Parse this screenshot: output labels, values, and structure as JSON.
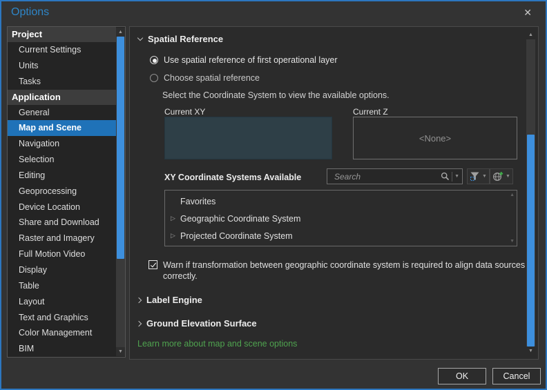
{
  "window": {
    "title": "Options"
  },
  "icons": {
    "close": "✕",
    "up": "▲",
    "down": "▼",
    "expand": "▷",
    "dropdown": "▼"
  },
  "colors": {
    "dialog_border": "#2c77c0",
    "title_blue": "#2e86c8",
    "selection_blue": "#1f72b8",
    "scrollbar_blue": "#3d8fdd",
    "link_green": "#4fa34f",
    "current_xy_fill": "#2e3f47"
  },
  "sidebar": {
    "sections": [
      {
        "header": "Project",
        "items": [
          {
            "label": "Current Settings"
          },
          {
            "label": "Units"
          },
          {
            "label": "Tasks"
          }
        ]
      },
      {
        "header": "Application",
        "items": [
          {
            "label": "General"
          },
          {
            "label": "Map and Scene",
            "selected": true
          },
          {
            "label": "Navigation"
          },
          {
            "label": "Selection"
          },
          {
            "label": "Editing"
          },
          {
            "label": "Geoprocessing"
          },
          {
            "label": "Device Location"
          },
          {
            "label": "Share and Download"
          },
          {
            "label": "Raster and Imagery"
          },
          {
            "label": "Full Motion Video"
          },
          {
            "label": "Display"
          },
          {
            "label": "Table"
          },
          {
            "label": "Layout"
          },
          {
            "label": "Text and Graphics"
          },
          {
            "label": "Color Management"
          },
          {
            "label": "BIM"
          }
        ]
      }
    ]
  },
  "main": {
    "spatial": {
      "title": "Spatial Reference",
      "radio_first_layer": "Use spatial reference of first operational layer",
      "radio_choose": "Choose spatial reference",
      "hint": "Select the Coordinate System to view the available options.",
      "current_xy_label": "Current XY",
      "current_z_label": "Current Z",
      "current_z_value": "<None>",
      "available_label": "XY Coordinate Systems Available",
      "search_placeholder": "Search",
      "list_items": [
        {
          "label": "Favorites"
        },
        {
          "label": "Geographic Coordinate System"
        },
        {
          "label": "Projected Coordinate System"
        }
      ],
      "warning": "Warn if transformation between geographic coordinate system is required to align data sources correctly."
    },
    "label_engine_title": "Label Engine",
    "ground_elevation_title": "Ground Elevation Surface",
    "learn_more": "Learn more about map and scene options"
  },
  "footer": {
    "ok": "OK",
    "cancel": "Cancel"
  }
}
